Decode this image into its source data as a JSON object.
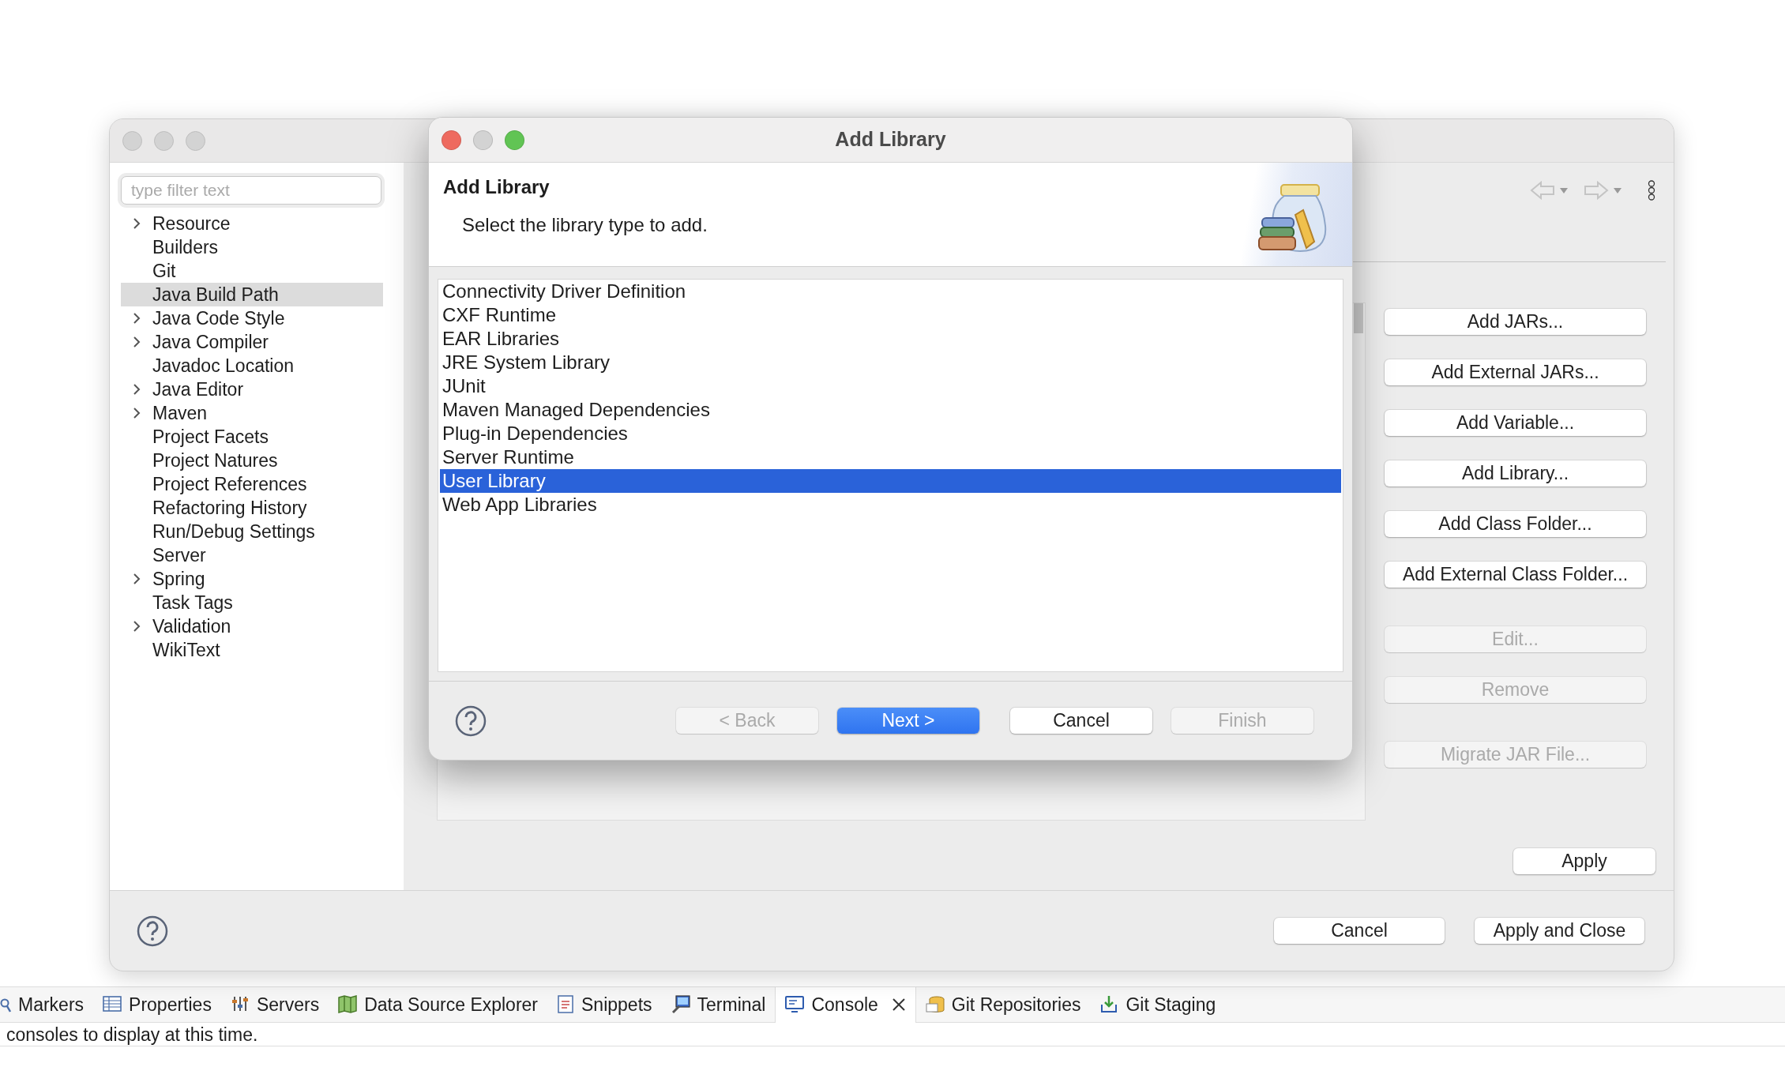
{
  "preferences_window": {
    "filter": {
      "placeholder": "type filter text"
    },
    "tree": [
      {
        "label": "Resource",
        "expandable": true,
        "selected": false
      },
      {
        "label": "Builders",
        "expandable": false,
        "selected": false
      },
      {
        "label": "Git",
        "expandable": false,
        "selected": false
      },
      {
        "label": "Java Build Path",
        "expandable": false,
        "selected": true
      },
      {
        "label": "Java Code Style",
        "expandable": true,
        "selected": false
      },
      {
        "label": "Java Compiler",
        "expandable": true,
        "selected": false
      },
      {
        "label": "Javadoc Location",
        "expandable": false,
        "selected": false
      },
      {
        "label": "Java Editor",
        "expandable": true,
        "selected": false
      },
      {
        "label": "Maven",
        "expandable": true,
        "selected": false
      },
      {
        "label": "Project Facets",
        "expandable": false,
        "selected": false
      },
      {
        "label": "Project Natures",
        "expandable": false,
        "selected": false
      },
      {
        "label": "Project References",
        "expandable": false,
        "selected": false
      },
      {
        "label": "Refactoring History",
        "expandable": false,
        "selected": false
      },
      {
        "label": "Run/Debug Settings",
        "expandable": false,
        "selected": false
      },
      {
        "label": "Server",
        "expandable": false,
        "selected": false
      },
      {
        "label": "Spring",
        "expandable": true,
        "selected": false
      },
      {
        "label": "Task Tags",
        "expandable": false,
        "selected": false
      },
      {
        "label": "Validation",
        "expandable": true,
        "selected": false
      },
      {
        "label": "WikiText",
        "expandable": false,
        "selected": false
      }
    ],
    "button_groups": [
      [
        {
          "label": "Add JARs...",
          "disabled": false
        },
        {
          "label": "Add External JARs...",
          "disabled": false
        },
        {
          "label": "Add Variable...",
          "disabled": false
        },
        {
          "label": "Add Library...",
          "disabled": false
        },
        {
          "label": "Add Class Folder...",
          "disabled": false
        },
        {
          "label": "Add External Class Folder...",
          "disabled": false
        }
      ],
      [
        {
          "label": "Edit...",
          "disabled": true
        },
        {
          "label": "Remove",
          "disabled": true
        }
      ],
      [
        {
          "label": "Migrate JAR File...",
          "disabled": true
        }
      ]
    ],
    "apply": "Apply",
    "footer_buttons": [
      "Cancel",
      "Apply and Close"
    ]
  },
  "dialog": {
    "title": "Add Library",
    "heading": "Add Library",
    "description": "Select the library type to add.",
    "library_types": [
      {
        "label": "Connectivity Driver Definition",
        "selected": false
      },
      {
        "label": "CXF Runtime",
        "selected": false
      },
      {
        "label": "EAR Libraries",
        "selected": false
      },
      {
        "label": "JRE System Library",
        "selected": false
      },
      {
        "label": "JUnit",
        "selected": false
      },
      {
        "label": "Maven Managed Dependencies",
        "selected": false
      },
      {
        "label": "Plug-in Dependencies",
        "selected": false
      },
      {
        "label": "Server Runtime",
        "selected": false
      },
      {
        "label": "User Library",
        "selected": true
      },
      {
        "label": "Web App Libraries",
        "selected": false
      }
    ],
    "buttons": [
      {
        "label": "< Back",
        "kind": "default",
        "disabled": true
      },
      {
        "label": "Next >",
        "kind": "primary",
        "disabled": false
      },
      {
        "label": "Cancel",
        "kind": "default",
        "disabled": false
      },
      {
        "label": "Finish",
        "kind": "default",
        "disabled": true
      }
    ]
  },
  "views": {
    "tabs": [
      {
        "label": "Markers",
        "selected": false,
        "closable": false
      },
      {
        "label": "Properties",
        "selected": false,
        "closable": false
      },
      {
        "label": "Servers",
        "selected": false,
        "closable": false
      },
      {
        "label": "Data Source Explorer",
        "selected": false,
        "closable": false
      },
      {
        "label": "Snippets",
        "selected": false,
        "closable": false
      },
      {
        "label": "Terminal",
        "selected": false,
        "closable": false
      },
      {
        "label": "Console",
        "selected": true,
        "closable": true
      },
      {
        "label": "Git Repositories",
        "selected": false,
        "closable": false
      },
      {
        "label": "Git Staging",
        "selected": false,
        "closable": false
      }
    ],
    "console_message": "consoles to display at this time."
  }
}
